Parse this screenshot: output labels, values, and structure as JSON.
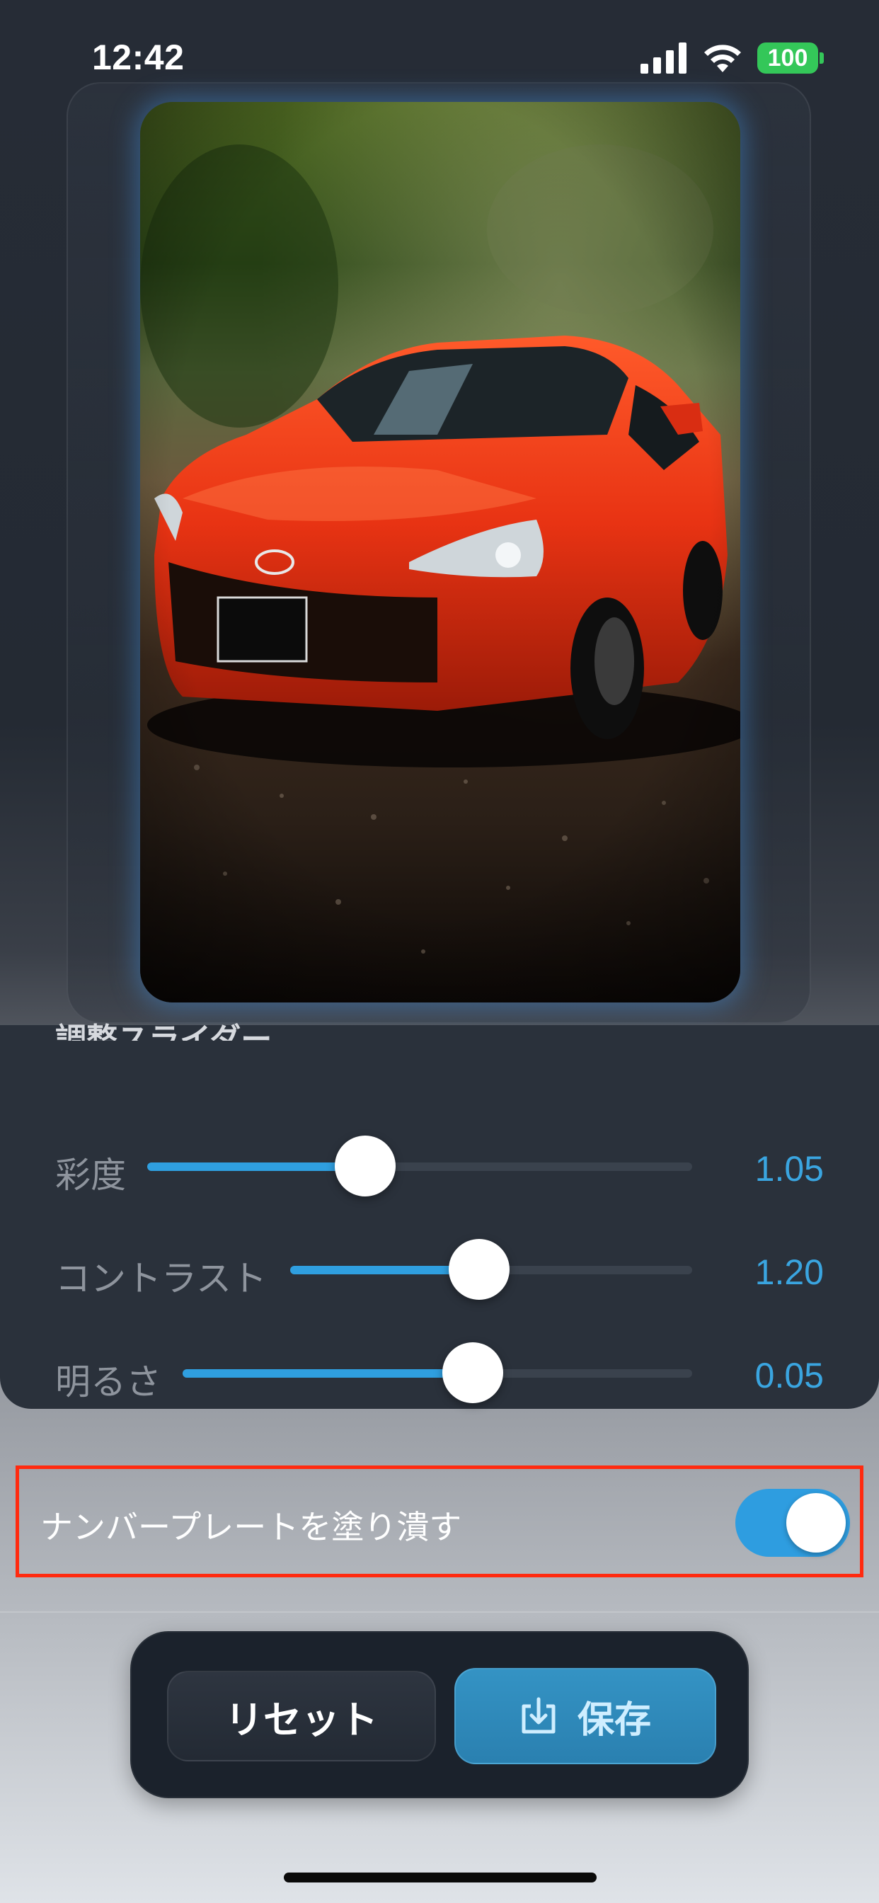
{
  "status_bar": {
    "time": "12:42",
    "battery": "100",
    "icons": [
      "cellular-signal-icon",
      "wifi-icon",
      "battery-icon"
    ]
  },
  "preview": {
    "image_description": "red sports car on gravel road with blurred green background"
  },
  "adjust": {
    "title": "調整スライダー",
    "sliders": [
      {
        "label": "彩度",
        "value": "1.05",
        "fraction": 0.4
      },
      {
        "label": "コントラスト",
        "value": "1.20",
        "fraction": 0.47
      },
      {
        "label": "明るさ",
        "value": "0.05",
        "fraction": 0.57
      }
    ]
  },
  "plate_toggle": {
    "label": "ナンバープレートを塗り潰す",
    "on": true
  },
  "actions": {
    "reset_label": "リセット",
    "save_label": "保存"
  },
  "colors": {
    "accent": "#2f9fe0",
    "highlight_border": "#ff2a0f",
    "battery": "#34c759"
  }
}
